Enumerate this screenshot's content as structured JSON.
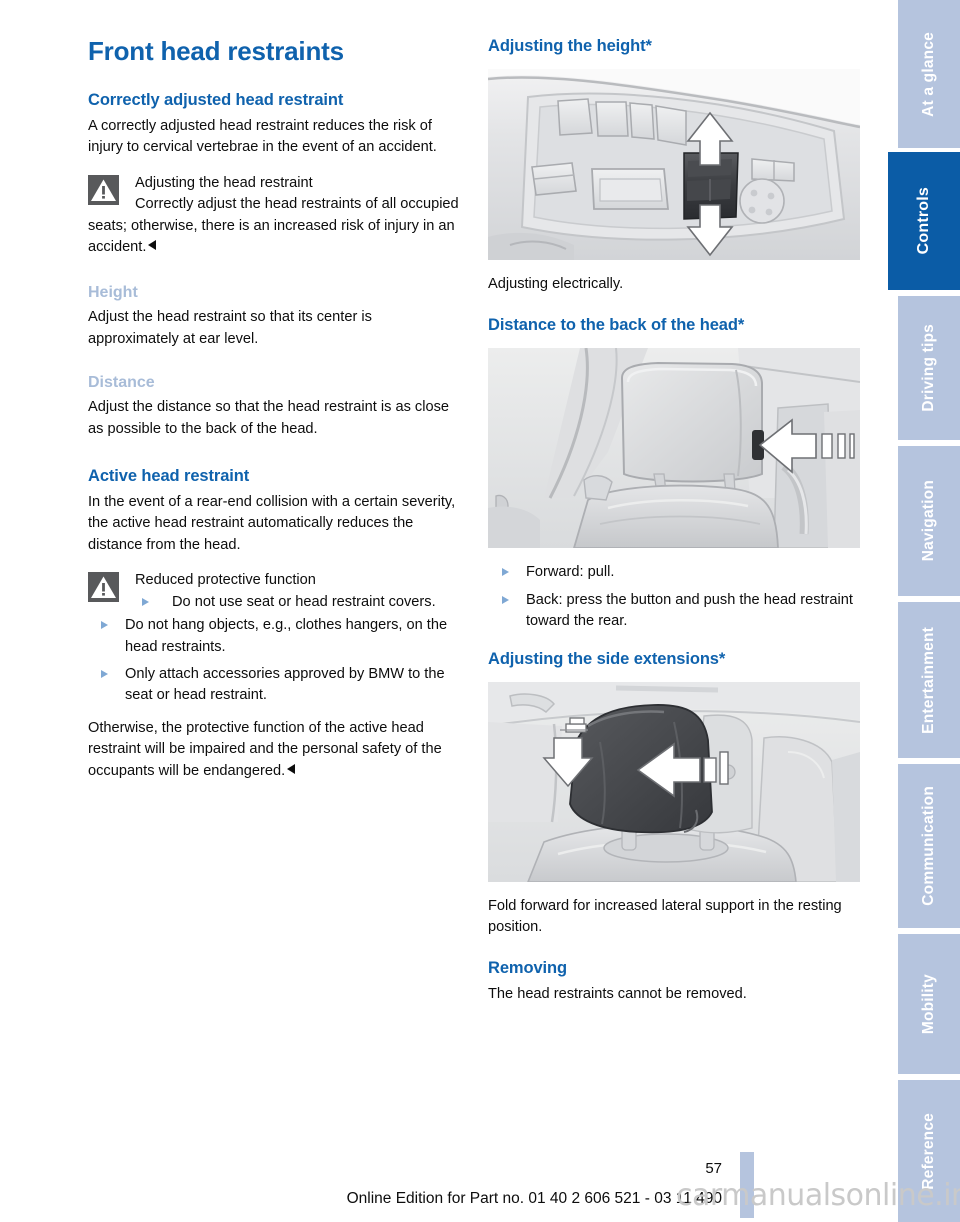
{
  "document": {
    "page_number": "57",
    "edition_line": "Online Edition for Part no. 01 40 2 606 521 - 03 11 490",
    "watermark": "carmanualsonline.info"
  },
  "colors": {
    "heading_blue": "#0f62ad",
    "subheading_blue_gray": "#a8bcd8",
    "tab_inactive": "#b5c4de",
    "tab_active": "#0b5ca6",
    "warning_icon_gray": "#58595b",
    "bullet_triangle": "#7fa8d4"
  },
  "left_column": {
    "title": "Front head restraints",
    "section1": {
      "heading": "Correctly adjusted head restraint",
      "paragraph": "A correctly adjusted head restraint reduces the risk of injury to cervical vertebrae in the event of an accident.",
      "warning": {
        "icon": "warning-triangle-icon",
        "title": "Adjusting the head restraint",
        "body": "Correctly adjust the head restraints of all occupied seats; otherwise, there is an increased risk of injury in an accident."
      }
    },
    "section2": {
      "heading": "Height",
      "paragraph": "Adjust the head restraint so that its center is approximately at ear level."
    },
    "section3": {
      "heading": "Distance",
      "paragraph": "Adjust the distance so that the head restraint is as close as possible to the back of the head."
    },
    "section4": {
      "heading": "Active head restraint",
      "paragraph": "In the event of a rear-end collision with a certain severity, the active head restraint automatically reduces the distance from the head.",
      "warning": {
        "icon": "warning-triangle-icon",
        "title": "Reduced protective function",
        "bullets": [
          "Do not use seat or head restraint covers.",
          "Do not hang objects, e.g., clothes hangers, on the head restraints.",
          "Only attach accessories approved by BMW to the seat or head restraint."
        ],
        "closing": "Otherwise, the protective function of the active head restraint will be impaired and the personal safety of the occupants will be endangered."
      }
    }
  },
  "right_column": {
    "section1": {
      "heading": "Adjusting the height*",
      "figure_alt": "seat-control-panel-figure",
      "caption": "Adjusting electrically."
    },
    "section2": {
      "heading": "Distance to the back of the head*",
      "figure_alt": "headrest-distance-figure",
      "bullets": [
        "Forward: pull.",
        "Back: press the button and push the head restraint toward the rear."
      ]
    },
    "section3": {
      "heading": "Adjusting the side extensions*",
      "figure_alt": "headrest-side-extensions-figure",
      "caption": "Fold forward for increased lateral support in the resting position."
    },
    "section4": {
      "heading": "Removing",
      "paragraph": "The head restraints cannot be removed."
    }
  },
  "sidenav": {
    "tabs": [
      {
        "label": "At a glance",
        "active": false
      },
      {
        "label": "Controls",
        "active": true
      },
      {
        "label": "Driving tips",
        "active": false
      },
      {
        "label": "Navigation",
        "active": false
      },
      {
        "label": "Entertainment",
        "active": false
      },
      {
        "label": "Communication",
        "active": false
      },
      {
        "label": "Mobility",
        "active": false
      },
      {
        "label": "Reference",
        "active": false
      }
    ]
  }
}
